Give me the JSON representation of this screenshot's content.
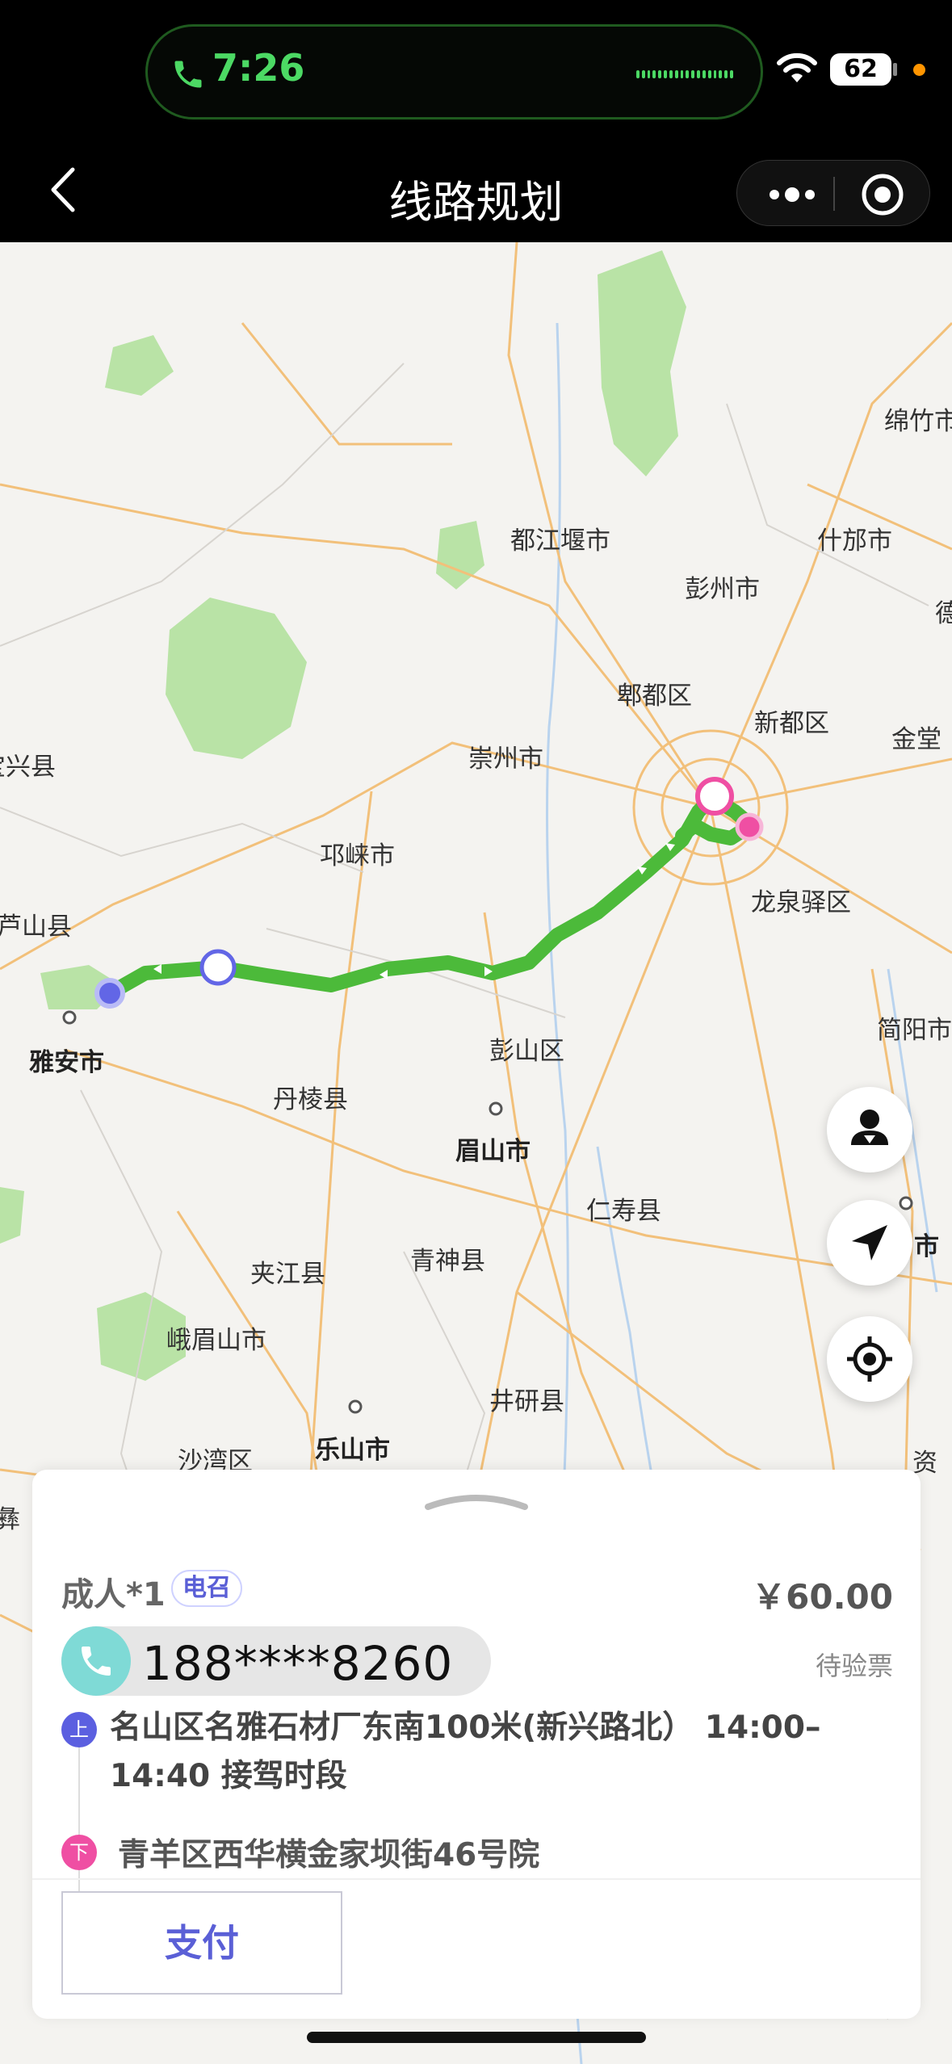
{
  "status_bar": {
    "call_time": "7:26",
    "battery": "62",
    "call_color": "#4cd964"
  },
  "nav": {
    "title": "线路规划",
    "back_icon": "chevron-left-icon",
    "more_icon": "more-dots-icon",
    "close_icon": "target-circle-icon"
  },
  "map": {
    "labels": {
      "mianzhu": "绵竹市",
      "dujiangyan": "都江堰市",
      "shifang": "什邡市",
      "pengzhou": "彭州市",
      "de": "德",
      "pixian": "郫都区",
      "xindu": "新都区",
      "jintang": "金堂",
      "baoxing": "宝兴县",
      "chongzhou": "崇州市",
      "qionglai": "邛崃市",
      "longquanyi": "龙泉驿区",
      "lushan": "芦山县",
      "yaan": "雅安市",
      "jianyang": "简阳市",
      "pengshan": "彭山区",
      "danleng": "丹棱县",
      "meishan": "眉山市",
      "renshou": "仁寿县",
      "shi_right": "市",
      "jiajiang": "夹江县",
      "qingshen": "青神县",
      "emeishan": "峨眉山市",
      "jingyan": "井研县",
      "shawan": "沙湾区",
      "leshan": "乐山市",
      "zi": "资",
      "yi": "彝"
    },
    "route_color": "#4cba3a",
    "start_color": "#6266e6",
    "end_color": "#ef4fa3"
  },
  "fabs": {
    "passenger_icon": "person-download-icon",
    "navigate_icon": "navigation-arrow-icon",
    "locate_icon": "crosshair-locate-icon"
  },
  "order": {
    "passenger": "成人*1",
    "tag": "电召",
    "price": "￥60.00",
    "phone": "188****8260",
    "status": "待验票",
    "pickup_badge": "上",
    "pickup": "名山区名雅石材厂东南100米(新兴路北）  14:00–14:40 接驾时段",
    "dropoff_badge": "下",
    "dropoff": "青羊区西华横金家坝街46号院",
    "pay_label": "支付"
  }
}
